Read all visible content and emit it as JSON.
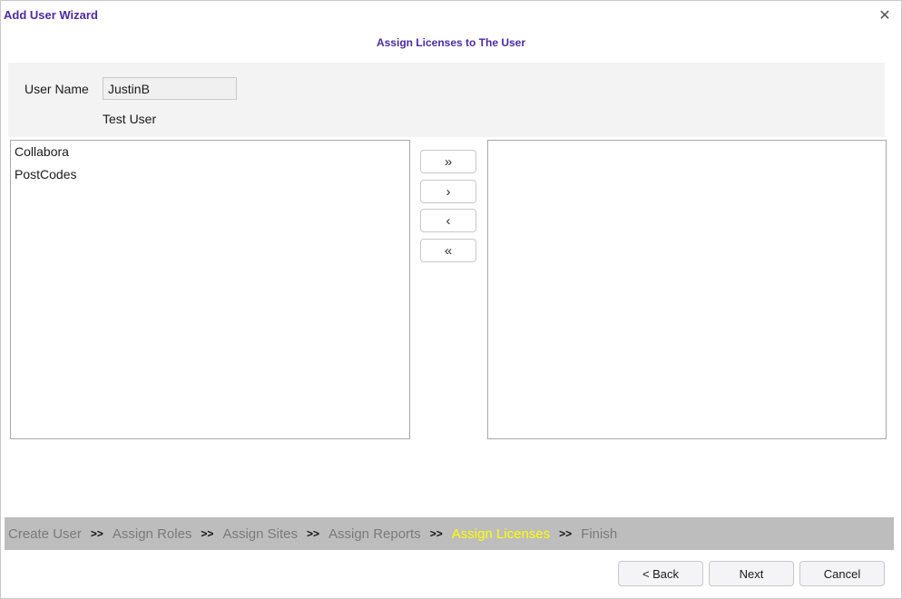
{
  "dialog": {
    "title": "Add User Wizard",
    "close_symbol": "✕",
    "subtitle": "Assign Licenses to The User"
  },
  "user": {
    "label": "User Name",
    "value": "JustinB",
    "description": "Test User"
  },
  "available_licenses": [
    "Collabora",
    "PostCodes"
  ],
  "assigned_licenses": [],
  "move_buttons": {
    "add_all": "»",
    "add": "›",
    "remove": "‹",
    "remove_all": "«"
  },
  "steps": {
    "separator": ">>",
    "items": [
      {
        "label": "Create User",
        "active": false
      },
      {
        "label": "Assign Roles",
        "active": false
      },
      {
        "label": "Assign Sites",
        "active": false
      },
      {
        "label": "Assign Reports",
        "active": false
      },
      {
        "label": "Assign Licenses",
        "active": true
      },
      {
        "label": "Finish",
        "active": false
      }
    ]
  },
  "footer": {
    "back": "< Back",
    "next": "Next",
    "cancel": "Cancel"
  },
  "colors": {
    "title": "#4b2aa0",
    "active_step": "#ffff00",
    "steps_bar": "#bdbdbd"
  }
}
